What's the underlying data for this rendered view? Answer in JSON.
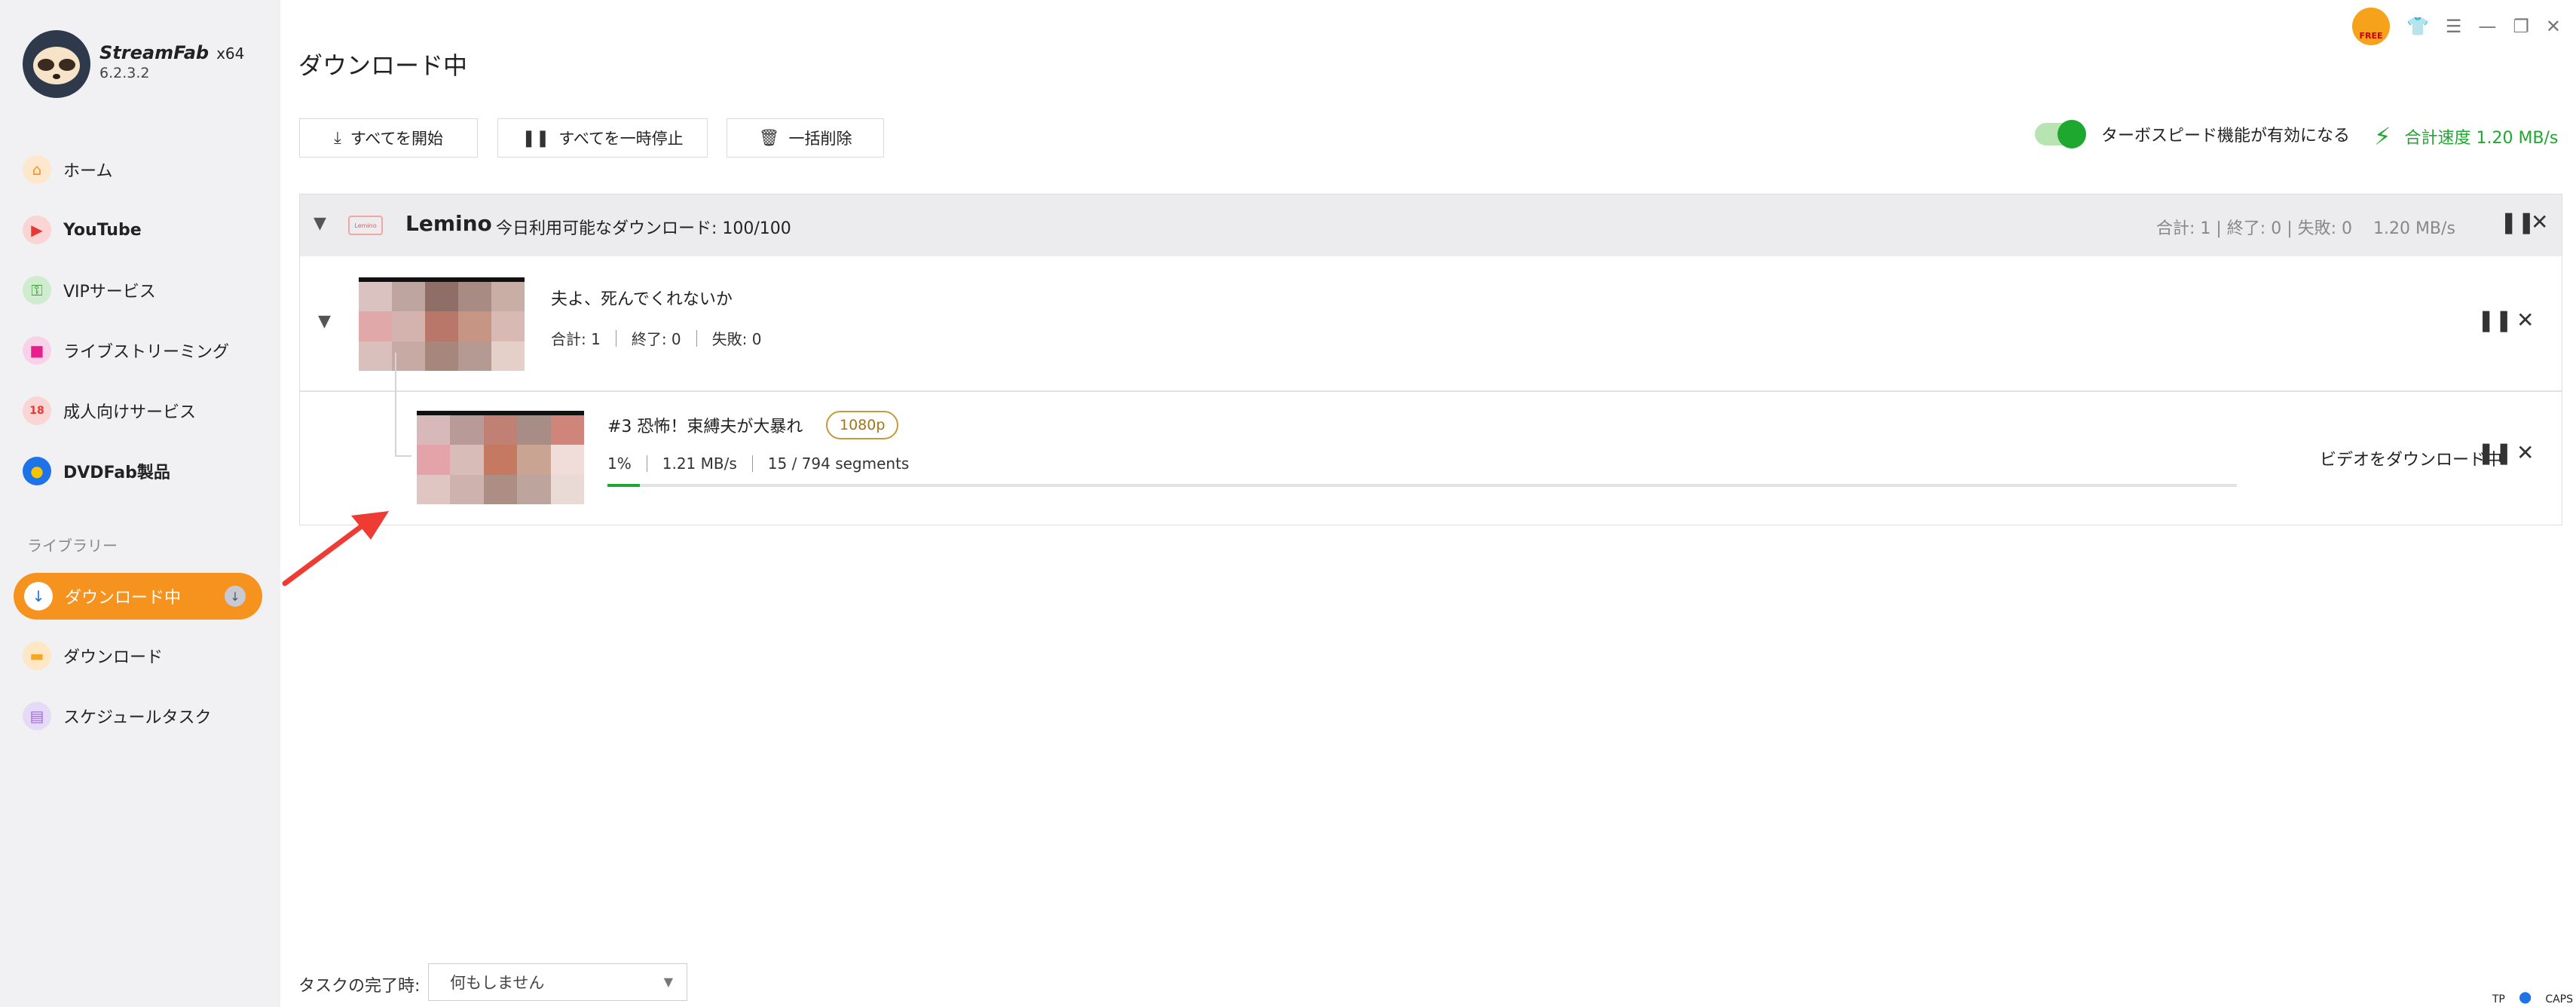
{
  "app": {
    "brand": "StreamFab",
    "arch": "x64",
    "version": "6.2.3.2"
  },
  "sidebar": {
    "items": [
      {
        "label": "ホーム",
        "icon": "home-icon",
        "color": "#f6921e"
      },
      {
        "label": "YouTube",
        "icon": "youtube-icon",
        "color": "#e53935"
      },
      {
        "label": "VIPサービス",
        "icon": "key-icon",
        "color": "#4caf50"
      },
      {
        "label": "ライブストリーミング",
        "icon": "video-camera-icon",
        "color": "#e91e8c"
      },
      {
        "label": "成人向けサービス",
        "icon": "adult-icon",
        "color": "#e53935"
      },
      {
        "label": "DVDFab製品",
        "icon": "dvdfab-icon",
        "color": "#1e73e8"
      }
    ],
    "library_label": "ライブラリー",
    "library": [
      {
        "label": "ダウンロード中",
        "icon": "download-icon",
        "active": true
      },
      {
        "label": "ダウンロード",
        "icon": "folder-icon",
        "color": "#f6a623"
      },
      {
        "label": "スケジュールタスク",
        "icon": "schedule-icon",
        "color": "#9c6bd8"
      }
    ]
  },
  "window": {
    "free_badge": "FREE"
  },
  "main": {
    "title": "ダウンロード中",
    "toolbar": {
      "start_all": "すべてを開始",
      "pause_all": "すべてを一時停止",
      "delete_all": "一括削除"
    },
    "turbo_label": "ターボスピード機能が有効になる",
    "total_speed": "合計速度 1.20 MB/s"
  },
  "group": {
    "service": "Lemino",
    "logo_text": "Lemino",
    "quota": "今日利用可能なダウンロード: 100/100",
    "stats": "合計: 1 | 終了: 0 | 失敗: 0    1.20 MB/s",
    "series": {
      "title": "夫よ、死んでくれないか",
      "total": "合計: 1",
      "done": "終了: 0",
      "failed": "失敗: 0"
    },
    "episode": {
      "title": "#3 恐怖！束縛夫が大暴れ",
      "quality": "1080p",
      "percent": "1%",
      "speed": "1.21 MB/s",
      "segments": "15 / 794 segments",
      "progress": 0.01,
      "status": "ビデオをダウンロード中"
    }
  },
  "footer": {
    "label": "タスクの完了時:",
    "option": "何もしません"
  },
  "tray": [
    "TP",
    "CAPS"
  ]
}
